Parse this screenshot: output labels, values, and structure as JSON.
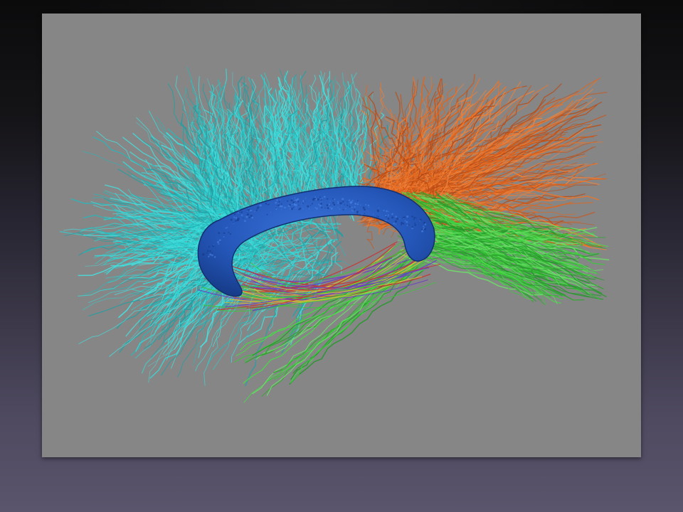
{
  "slide": {
    "background_top": "#0b0b0c",
    "background_bottom": "#5a546c"
  },
  "image": {
    "subject": "brain-tractography-render",
    "background_color": "#868686",
    "fiber_colors": {
      "frontal": "#2fcfcf",
      "parietal": "#e0661e",
      "posterior": "#39c93a",
      "mixed": [
        "#c93030",
        "#d8c030",
        "#6a3ac9",
        "#39c93a"
      ]
    },
    "structure_color": "#1f50b8"
  }
}
